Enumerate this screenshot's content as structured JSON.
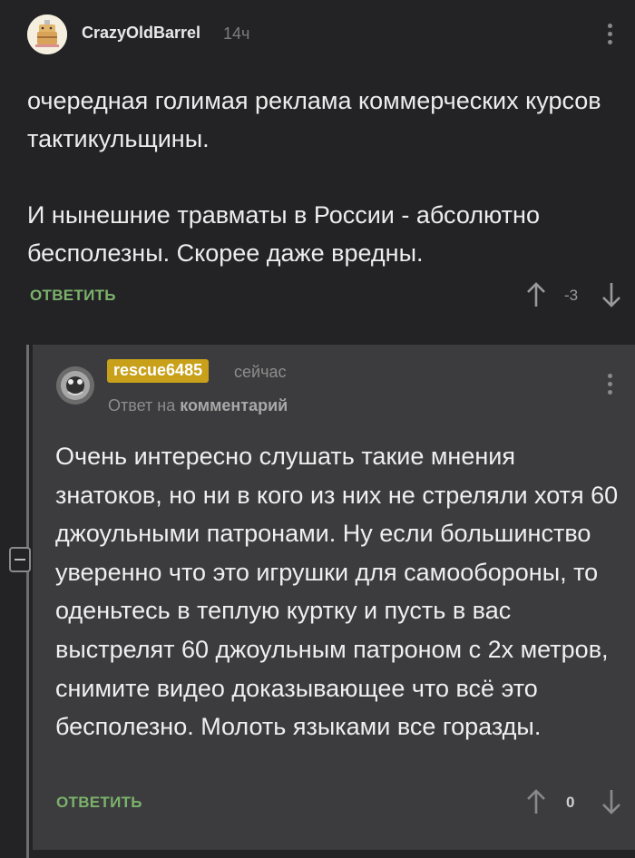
{
  "comment": {
    "author": "CrazyOldBarrel",
    "time": "14ч",
    "paragraphs": [
      "очередная голимая реклама коммерческих курсов тактикульщины.",
      "И нынешние травматы в России - абсолютно бесполезны. Скорее даже вредны."
    ],
    "reply_label": "ОТВЕТИТЬ",
    "score": "-3"
  },
  "reply": {
    "author": "rescue6485",
    "time": "сейчас",
    "reply_to_prefix": "Ответ на",
    "reply_to_target": "комментарий",
    "text": "Очень интересно слушать такие мнения знатоков, но ни в кого из них не стреляли хотя 60 джоульными патронами. Ну если большинство уверенно что это игрушки для самообороны, то оденьтесь в теплую куртку и пусть в вас выстрелят 60 джоульным патроном с 2х метров, снимите видео доказывающее что всё это бесполезно. Молоть языками все горазды.",
    "reply_label": "ОТВЕТИТЬ",
    "score": "0"
  },
  "colors": {
    "background": "#232325",
    "reply_background": "#3c3c3e",
    "reply_action": "#7bb26b",
    "author_badge": "#c8a01a"
  },
  "icons": [
    "avatar-barrel",
    "avatar-user",
    "more-vertical-icon",
    "arrow-up-icon",
    "arrow-down-icon",
    "collapse-minus-icon"
  ]
}
